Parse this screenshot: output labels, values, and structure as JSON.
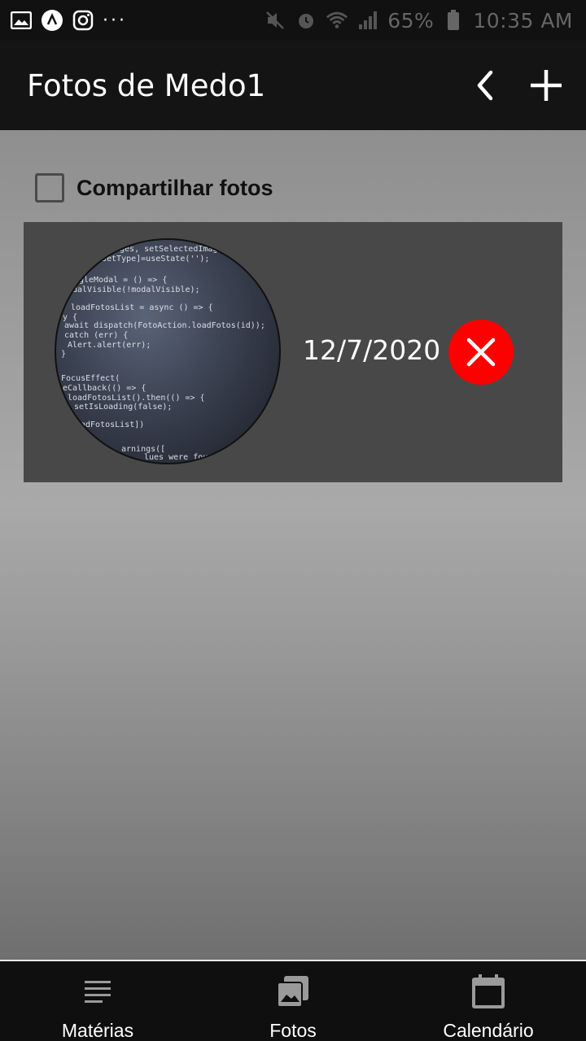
{
  "status_bar": {
    "battery": "65%",
    "time": "10:35 AM",
    "more": "···",
    "icons_left": [
      "gallery-icon",
      "app-icon",
      "instagram-icon"
    ],
    "icons_right": [
      "mute-icon",
      "alarm-icon",
      "wifi-icon",
      "signal-icon",
      "battery-icon"
    ]
  },
  "app_bar": {
    "title": "Fotos de Medo1",
    "back_icon": "chevron-left-icon",
    "add_icon": "plus-icon"
  },
  "main": {
    "share_checkbox_label": "Compartilhar fotos",
    "share_checked": false,
    "photos": [
      {
        "date": "12/7/2020",
        "delete_icon": "close-icon",
        "thumbnail": "photo-thumbnail",
        "code_lines": [
          "ages, setSelectedImages]",
          "setType]=useState('');",
          "gleModal = () => {",
          "dalVisible(!modalVisible);",
          "loadFotosList = async () => {",
          "y {",
          "await dispatch(FotoAction.loadFotos(id));",
          "catch (err) {",
          "Alert.alert(err);",
          "}",
          "FocusEffect(",
          "eCallback(() => {",
          "loadFotosList().then(() => {",
          "setIsLoading(false);",
          "adFotosList])",
          "arnings([",
          "lues were found"
        ]
      }
    ]
  },
  "bottom_nav": {
    "items": [
      {
        "label": "Matérias",
        "icon": "list-icon"
      },
      {
        "label": "Fotos",
        "icon": "photos-icon"
      },
      {
        "label": "Calendário",
        "icon": "calendar-icon"
      }
    ]
  },
  "colors": {
    "app_bar": "#141414",
    "card": "#484848",
    "delete": "#ff0000",
    "nav": "#0f0f0f"
  }
}
